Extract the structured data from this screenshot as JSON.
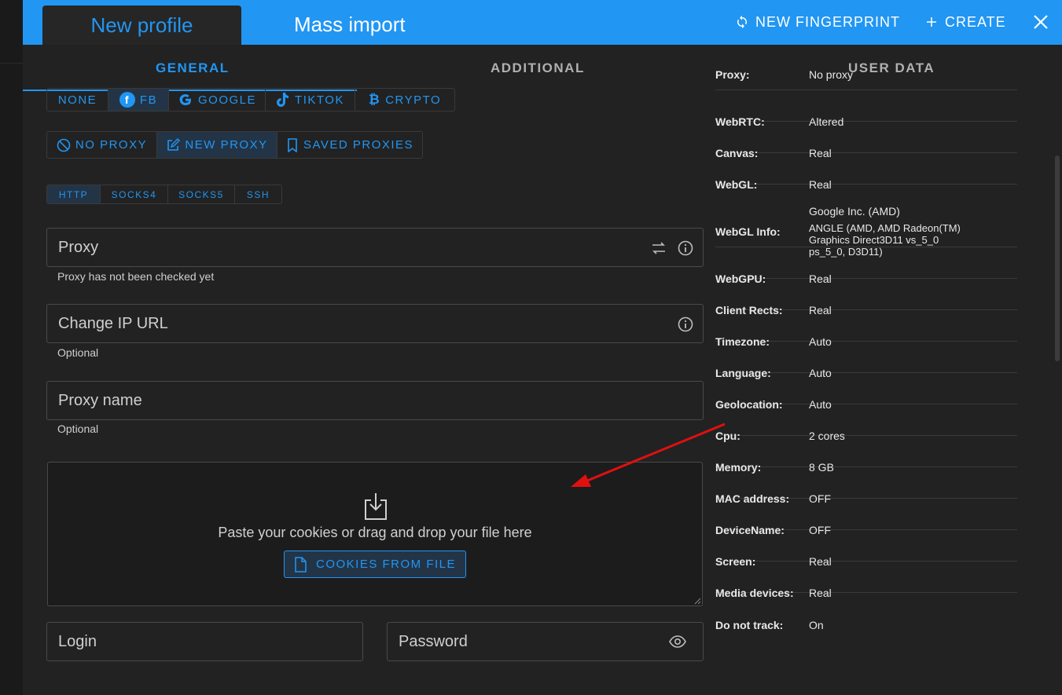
{
  "header": {
    "tab_new_profile": "New profile",
    "tab_mass_import": "Mass import",
    "new_fingerprint": "NEW FINGERPRINT",
    "create": "CREATE"
  },
  "subtabs": [
    "GENERAL",
    "ADDITIONAL",
    "USER DATA"
  ],
  "social_buttons": [
    "NONE",
    "FB",
    "GOOGLE",
    "TIKTOK",
    "CRYPTO"
  ],
  "proxy_modes": [
    "NO PROXY",
    "NEW PROXY",
    "SAVED PROXIES"
  ],
  "protocols": [
    "HTTP",
    "SOCKS4",
    "SOCKS5",
    "SSH"
  ],
  "fields": {
    "proxy_placeholder": "Proxy",
    "proxy_hint": "Proxy has not been checked yet",
    "change_ip_placeholder": "Change IP URL",
    "change_ip_hint": "Optional",
    "proxy_name_placeholder": "Proxy name",
    "proxy_name_hint": "Optional",
    "login_placeholder": "Login",
    "password_placeholder": "Password"
  },
  "cookies": {
    "drop_text": "Paste your cookies or drag and drop your file here",
    "button": "COOKIES FROM FILE"
  },
  "fingerprint_info": [
    {
      "key": "Proxy:",
      "value": "No proxy"
    },
    {
      "key": "WebRTC:",
      "value": "Altered"
    },
    {
      "key": "Canvas:",
      "value": "Real"
    },
    {
      "key": "WebGL:",
      "value": "Real"
    },
    {
      "key": "WebGL Info:",
      "value": "Google Inc. (AMD)",
      "value2": "ANGLE (AMD, AMD Radeon(TM) Graphics Direct3D11 vs_5_0 ps_5_0, D3D11)"
    },
    {
      "key": "WebGPU:",
      "value": "Real"
    },
    {
      "key": "Client Rects:",
      "value": "Real"
    },
    {
      "key": "Timezone:",
      "value": "Auto"
    },
    {
      "key": "Language:",
      "value": "Auto"
    },
    {
      "key": "Geolocation:",
      "value": "Auto"
    },
    {
      "key": "Cpu:",
      "value": "2 cores"
    },
    {
      "key": "Memory:",
      "value": "8 GB"
    },
    {
      "key": "MAC address:",
      "value": "OFF"
    },
    {
      "key": "DeviceName:",
      "value": "OFF"
    },
    {
      "key": "Screen:",
      "value": "Real"
    },
    {
      "key": "Media devices:",
      "value": "Real"
    },
    {
      "key": "Do not track:",
      "value": "On"
    }
  ],
  "colors": {
    "accent": "#2196f3",
    "background": "#222222",
    "annotation_arrow": "#e01010"
  }
}
